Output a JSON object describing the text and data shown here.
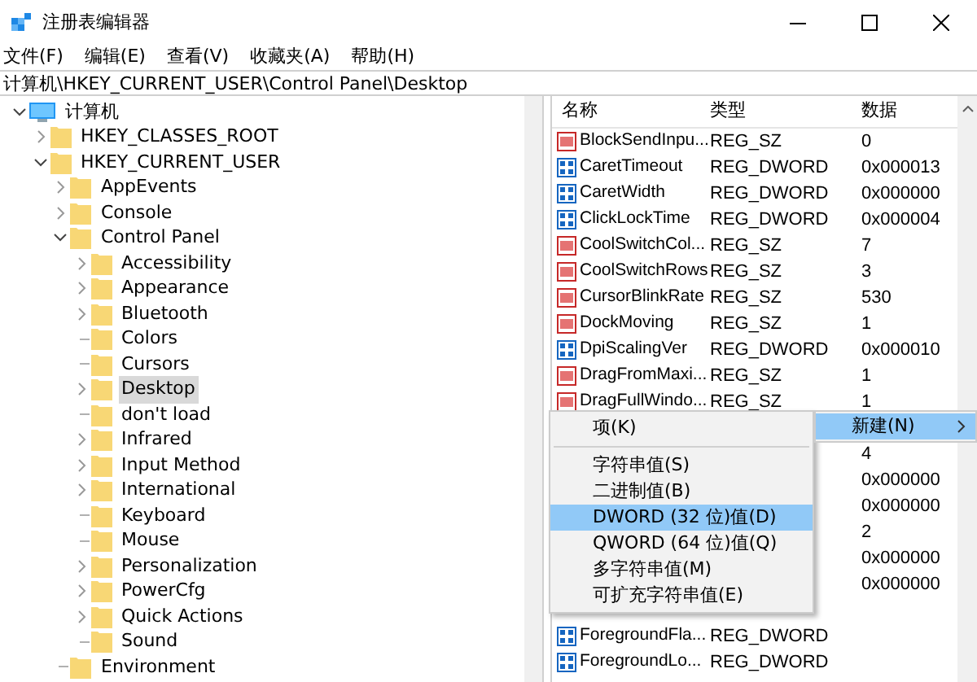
{
  "window": {
    "title": "注册表编辑器"
  },
  "menu": [
    "文件(F)",
    "编辑(E)",
    "查看(V)",
    "收藏夹(A)",
    "帮助(H)"
  ],
  "address": "计算机\\HKEY_CURRENT_USER\\Control Panel\\Desktop",
  "tree": [
    {
      "label": "计算机",
      "kind": "computer",
      "expanded": true,
      "selected": false,
      "children": [
        {
          "label": "HKEY_CLASSES_ROOT",
          "kind": "branch",
          "expanded": false,
          "selected": false
        },
        {
          "label": "HKEY_CURRENT_USER",
          "kind": "branch",
          "expanded": true,
          "selected": false,
          "children": [
            {
              "label": "AppEvents",
              "kind": "branch",
              "expanded": false,
              "selected": false
            },
            {
              "label": "Console",
              "kind": "branch",
              "expanded": false,
              "selected": false
            },
            {
              "label": "Control Panel",
              "kind": "branch",
              "expanded": true,
              "selected": false,
              "children": [
                {
                  "label": "Accessibility",
                  "kind": "branch",
                  "expanded": false,
                  "selected": false
                },
                {
                  "label": "Appearance",
                  "kind": "branch",
                  "expanded": false,
                  "selected": false
                },
                {
                  "label": "Bluetooth",
                  "kind": "branch",
                  "expanded": false,
                  "selected": false
                },
                {
                  "label": "Colors",
                  "kind": "leaf",
                  "selected": false
                },
                {
                  "label": "Cursors",
                  "kind": "leaf",
                  "selected": false
                },
                {
                  "label": "Desktop",
                  "kind": "branch",
                  "expanded": false,
                  "selected": true
                },
                {
                  "label": "don't load",
                  "kind": "leaf",
                  "selected": false
                },
                {
                  "label": "Infrared",
                  "kind": "branch",
                  "expanded": false,
                  "selected": false
                },
                {
                  "label": "Input Method",
                  "kind": "branch",
                  "expanded": false,
                  "selected": false
                },
                {
                  "label": "International",
                  "kind": "branch",
                  "expanded": false,
                  "selected": false
                },
                {
                  "label": "Keyboard",
                  "kind": "leaf",
                  "selected": false
                },
                {
                  "label": "Mouse",
                  "kind": "leaf",
                  "selected": false
                },
                {
                  "label": "Personalization",
                  "kind": "branch",
                  "expanded": false,
                  "selected": false
                },
                {
                  "label": "PowerCfg",
                  "kind": "branch",
                  "expanded": false,
                  "selected": false
                },
                {
                  "label": "Quick Actions",
                  "kind": "branch",
                  "expanded": false,
                  "selected": false
                },
                {
                  "label": "Sound",
                  "kind": "leaf",
                  "selected": false
                }
              ]
            },
            {
              "label": "Environment",
              "kind": "leaf",
              "selected": false
            }
          ]
        }
      ]
    }
  ],
  "table": {
    "columns": [
      "名称",
      "类型",
      "数据"
    ],
    "rows": [
      {
        "kind": "string",
        "name": "BlockSendInpu...",
        "type": "REG_SZ",
        "data": "0"
      },
      {
        "kind": "binary",
        "name": "CaretTimeout",
        "type": "REG_DWORD",
        "data": "0x000013"
      },
      {
        "kind": "binary",
        "name": "CaretWidth",
        "type": "REG_DWORD",
        "data": "0x000000"
      },
      {
        "kind": "binary",
        "name": "ClickLockTime",
        "type": "REG_DWORD",
        "data": "0x000004"
      },
      {
        "kind": "string",
        "name": "CoolSwitchCol...",
        "type": "REG_SZ",
        "data": "7"
      },
      {
        "kind": "string",
        "name": "CoolSwitchRows",
        "type": "REG_SZ",
        "data": "3"
      },
      {
        "kind": "string",
        "name": "CursorBlinkRate",
        "type": "REG_SZ",
        "data": "530"
      },
      {
        "kind": "string",
        "name": "DockMoving",
        "type": "REG_SZ",
        "data": "1"
      },
      {
        "kind": "binary",
        "name": "DpiScalingVer",
        "type": "REG_DWORD",
        "data": "0x000010"
      },
      {
        "kind": "string",
        "name": "DragFromMaxi...",
        "type": "REG_SZ",
        "data": "1"
      },
      {
        "kind": "string",
        "name": "DragFullWindo...",
        "type": "REG_SZ",
        "data": "1"
      },
      {
        "kind": "hidden"
      },
      {
        "kind": "hidden",
        "data": "4"
      },
      {
        "kind": "hidden",
        "data": "0x000000"
      },
      {
        "kind": "hidden",
        "data": "0x000000"
      },
      {
        "kind": "hidden",
        "data": "2"
      },
      {
        "kind": "hidden",
        "data": "0x000000"
      },
      {
        "kind": "hidden",
        "data": "0x000000"
      },
      {
        "kind": "hidden"
      },
      {
        "kind": "binary",
        "name": "ForegroundFla...",
        "type": "REG_DWORD"
      },
      {
        "kind": "binary",
        "name": "ForegroundLo...",
        "type": "REG_DWORD"
      }
    ]
  },
  "context_menu": {
    "items": [
      {
        "label": "新建(N)",
        "selected": true
      }
    ]
  },
  "submenu": {
    "items": [
      {
        "kind": "item",
        "label": "项(K)",
        "selected": false
      },
      {
        "kind": "separator"
      },
      {
        "kind": "item",
        "label": "字符串值(S)",
        "selected": false
      },
      {
        "kind": "item",
        "label": "二进制值(B)",
        "selected": false
      },
      {
        "kind": "item",
        "label": "DWORD (32 位)值(D)",
        "selected": true
      },
      {
        "kind": "item",
        "label": "QWORD (64 位)值(Q)",
        "selected": false
      },
      {
        "kind": "item",
        "label": "多字符串值(M)",
        "selected": false
      },
      {
        "kind": "item",
        "label": "可扩充字符串值(E)",
        "selected": false
      }
    ]
  }
}
